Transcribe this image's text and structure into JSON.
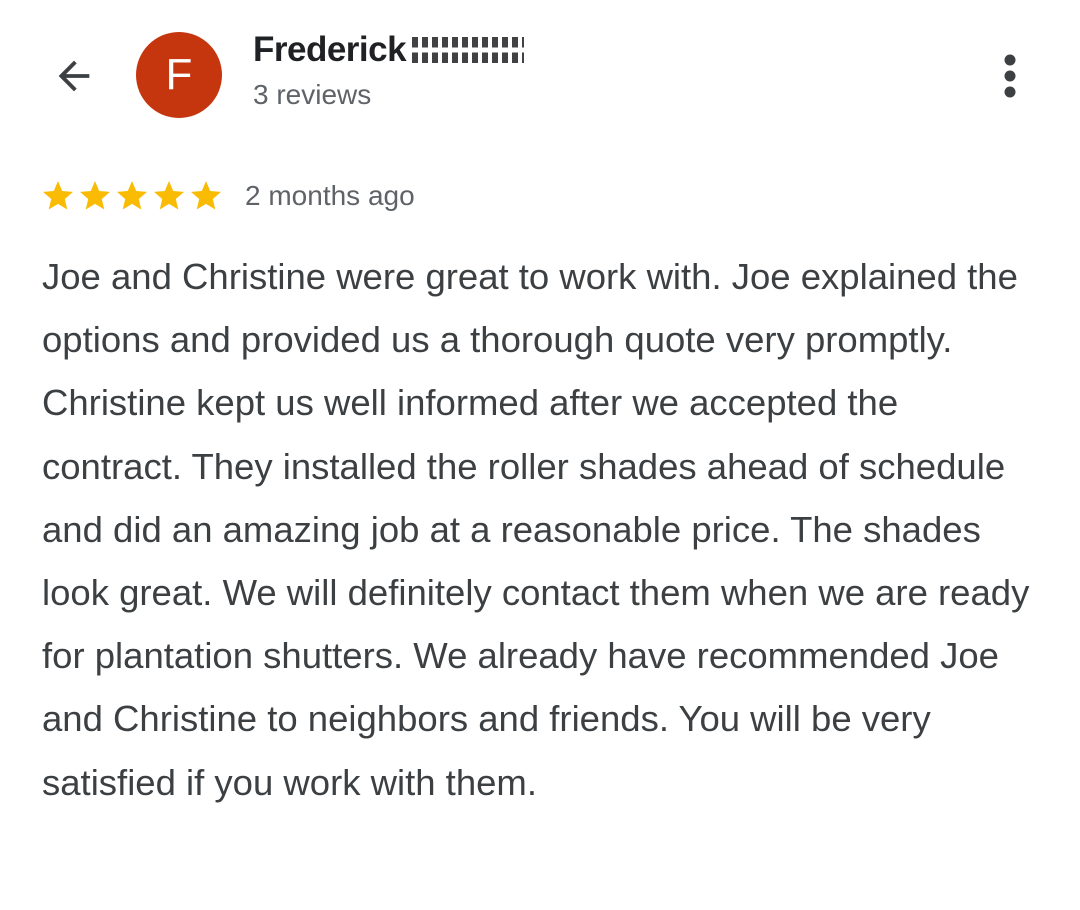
{
  "header": {
    "back_icon": "arrow-back-icon",
    "avatar": {
      "letter": "F",
      "color": "#c5360f"
    },
    "reviewer_name": "Frederick",
    "review_count": "3 reviews",
    "more_icon": "more-vert-icon"
  },
  "review": {
    "rating": 5,
    "rating_max": 5,
    "star_color": "#f9bb04",
    "time_ago": "2 months ago",
    "text": "Joe and Christine were great to work with. Joe explained the options and provided us a thorough quote very promptly. Christine kept us well informed after we accepted the contract. They installed the roller shades ahead of schedule and did an amazing job at a reasonable price. The shades look great. We will definitely contact them when we are ready for plantation shutters. We already have recommended Joe and Christine to neighbors and friends. You will be very satisfied if you work with them."
  },
  "colors": {
    "primary_text": "#202124",
    "secondary_text": "#5f6368",
    "body_text": "#3c4043"
  }
}
